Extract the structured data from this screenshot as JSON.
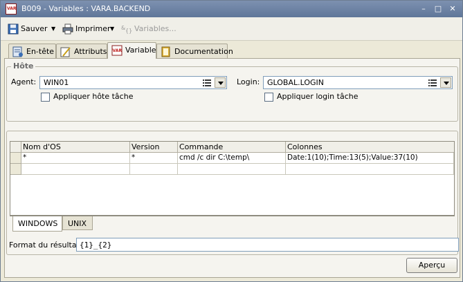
{
  "window": {
    "title": "B009 - Variables : VARA.BACKEND",
    "app_icon_text": "VAR",
    "minimize": "–",
    "maximize": "□",
    "close": "✕"
  },
  "toolbar": {
    "save_label": "Sauver",
    "print_label": "Imprimer",
    "variables_label": "Variables...",
    "dropdown_glyph": "▼"
  },
  "tabs": [
    {
      "label": "En-tête",
      "icon": "header-icon"
    },
    {
      "label": "Attributs",
      "icon": "attributes-icon"
    },
    {
      "label": "Variable",
      "icon": "variable-icon",
      "active": true
    },
    {
      "label": "Documentation",
      "icon": "book-icon"
    }
  ],
  "host": {
    "group_title": "Hôte",
    "agent_label": "Agent:",
    "agent_value": "WIN01",
    "apply_host_label": "Appliquer hôte tâche",
    "login_label": "Login:",
    "login_value": "GLOBAL.LOGIN",
    "apply_login_label": "Appliquer login tâche"
  },
  "grid": {
    "columns": [
      "Nom d'OS",
      "Version",
      "Commande",
      "Colonnes"
    ],
    "rows": [
      [
        "*",
        "*",
        "cmd /c dir C:\\temp\\",
        "Date:1(10);Time:13(5);Value:37(10)"
      ]
    ]
  },
  "subtabs": [
    {
      "label": "WINDOWS",
      "active": true
    },
    {
      "label": "UNIX"
    }
  ],
  "result_format": {
    "label": "Format du résultat:",
    "value": "{1}_{2}"
  },
  "preview_button": "Aperçu"
}
